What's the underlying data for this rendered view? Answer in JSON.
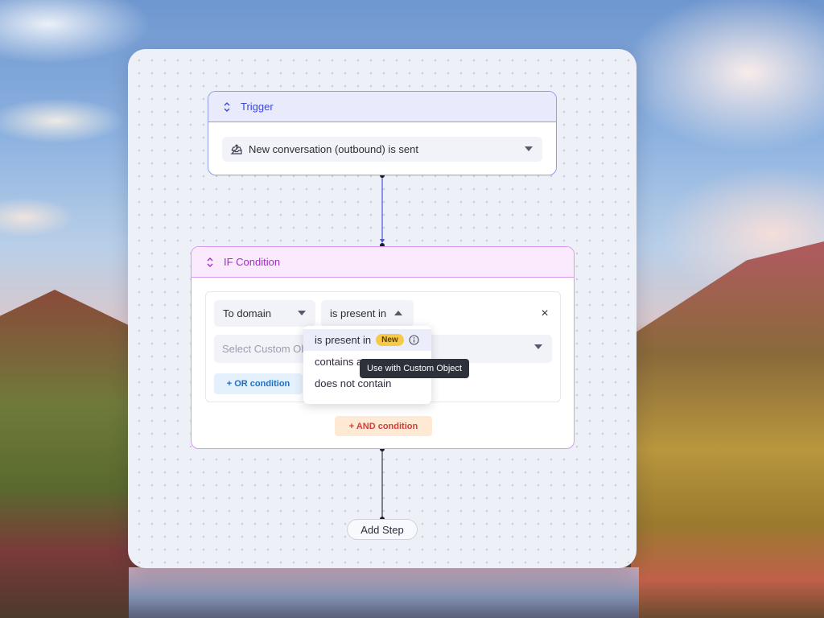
{
  "trigger": {
    "title": "Trigger",
    "selected_event": "New conversation (outbound) is sent"
  },
  "if_condition": {
    "title": "IF Condition",
    "field_select": "To domain",
    "operator_select": "is present in",
    "value_placeholder": "Select Custom Ob",
    "or_button": "+ OR condition",
    "and_button": "+ AND condition"
  },
  "operator_dropdown": {
    "options": [
      {
        "label": "is present in",
        "badge": "New"
      },
      {
        "label": "contains a"
      },
      {
        "label": "does not contain"
      }
    ],
    "tooltip": "Use with Custom Object"
  },
  "add_step": {
    "label": "Add Step"
  },
  "colors": {
    "trigger_accent": "#3b47d6",
    "if_accent": "#a22ac8",
    "or_accent": "#1f6fc4",
    "and_accent": "#d2403a",
    "badge": "#f7c948"
  }
}
